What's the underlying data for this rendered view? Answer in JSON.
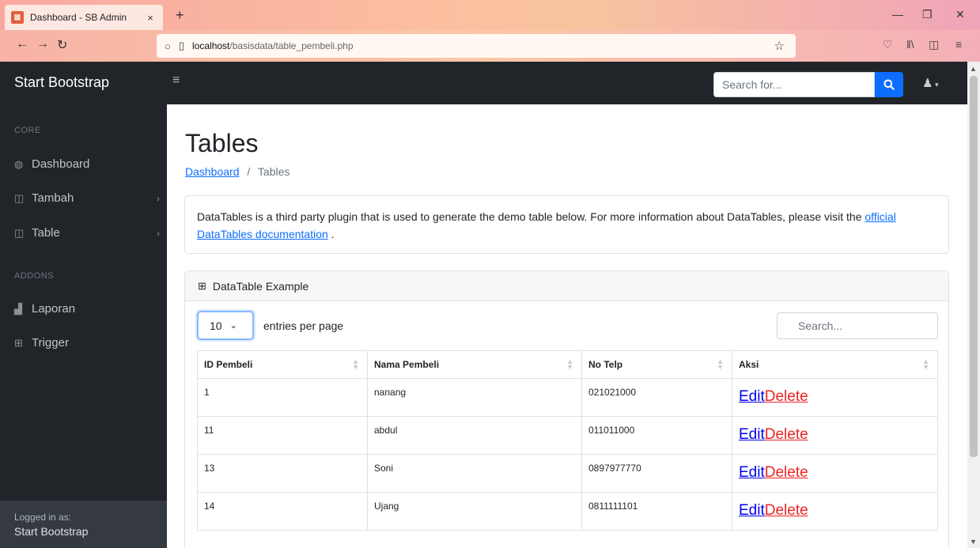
{
  "browser": {
    "tab_title": "Dashboard - SB Admin",
    "tab_close": "×",
    "new_tab": "+",
    "url_host": "localhost",
    "url_path": "/basisdata/table_pembeli.php"
  },
  "topnav": {
    "brand": "Start Bootstrap",
    "search_placeholder": "Search for..."
  },
  "sidebar": {
    "heading_core": "CORE",
    "heading_addons": "ADDONS",
    "items": [
      {
        "label": "Dashboard",
        "icon": "tachometer-icon"
      },
      {
        "label": "Tambah",
        "icon": "columns-icon",
        "has_arrow": true
      },
      {
        "label": "Table",
        "icon": "columns-icon",
        "has_arrow": true
      },
      {
        "label": "Laporan",
        "icon": "chart-area-icon"
      },
      {
        "label": "Trigger",
        "icon": "table-icon"
      }
    ],
    "footer_small": "Logged in as:",
    "footer_name": "Start Bootstrap"
  },
  "main": {
    "title": "Tables",
    "breadcrumb_link": "Dashboard",
    "breadcrumb_sep": "/",
    "breadcrumb_current": "Tables",
    "info_text": "DataTables is a third party plugin that is used to generate the demo table below. For more information about DataTables, please visit the",
    "info_link": "official DataTables documentation",
    "info_end": "."
  },
  "datatable": {
    "header": "DataTable Example",
    "entries_value": "10",
    "entries_label": "entries per page",
    "search_placeholder": "Search...",
    "columns": [
      "ID Pembeli",
      "Nama Pembeli",
      "No Telp",
      "Aksi"
    ],
    "rows": [
      {
        "id": "1",
        "nama": "nanang",
        "telp": "021021000"
      },
      {
        "id": "11",
        "nama": "abdul",
        "telp": "011011000"
      },
      {
        "id": "13",
        "nama": "Soni",
        "telp": "0897977770"
      },
      {
        "id": "14",
        "nama": "Ujang",
        "telp": "0811111101"
      }
    ],
    "edit_label": "Edit",
    "delete_label": "Delete"
  },
  "colors": {
    "sidebar_bg": "#212529",
    "primary": "#0d6efd",
    "delete": "#ee2222"
  }
}
